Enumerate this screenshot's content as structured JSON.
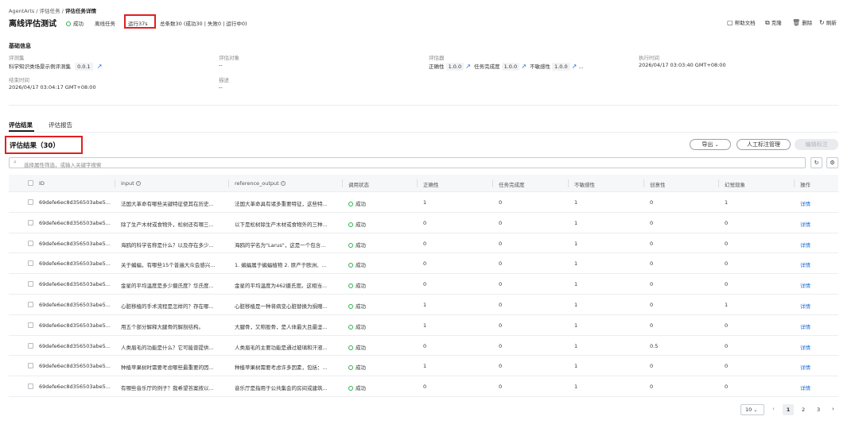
{
  "breadcrumb": [
    "AgentArts",
    "评估任务",
    "评估任务详情"
  ],
  "page_title": "离线评估测试",
  "status": {
    "label": "成功",
    "color": "#2bb34a"
  },
  "task_type": "离线任务",
  "runtime": "运行37s",
  "summary": "总条数30 (成功30 | 失败0 | 运行中0)",
  "toolbar": {
    "help": "帮助文档",
    "clone": "克隆",
    "delete": "删除",
    "refresh": "刷新"
  },
  "basic_info": {
    "section_title": "基础信息",
    "dataset_label": "评测集",
    "dataset_value": "科学知识类场景示例评测集",
    "dataset_version": "0.0.1",
    "target_label": "评估对象",
    "target_value": "--",
    "evaluators_label": "评估器",
    "evaluators": [
      {
        "name": "正确性",
        "version": "1.0.0"
      },
      {
        "name": "任务完成度",
        "version": "1.0.0"
      },
      {
        "name": "不敏感性",
        "version": "1.0.0"
      }
    ],
    "evaluators_more": "...",
    "exec_time_label": "执行时间",
    "exec_time_value": "2026/04/17 03:03:40 GMT+08:00",
    "end_time_label": "结束时间",
    "end_time_value": "2026/04/17 03:04:17 GMT+08:00",
    "desc_label": "描述",
    "desc_value": "--"
  },
  "tabs": [
    {
      "label": "评估结果",
      "active": true
    },
    {
      "label": "评估报告",
      "active": false
    }
  ],
  "results": {
    "title": "评估结果（30）",
    "export_label": "导出",
    "annotate_label": "人工标注管理",
    "batch_label": "编辑标注",
    "search_placeholder": "选择属性筛选，或输入关键字搜索"
  },
  "table": {
    "columns": [
      "ID",
      "input",
      "reference_output",
      "调用状态",
      "正确性",
      "任务完成度",
      "不敏感性",
      "创意性",
      "幻觉现象",
      "操作"
    ],
    "status_label": "成功",
    "action_label": "详情",
    "rows": [
      {
        "id": "69defe6ec8d356503abe5...",
        "input": "法国大革命有哪些关键特征使其在历史...",
        "ref": "法国大革命具有诸多重要特征，这些特...",
        "c1": "1",
        "c2": "0",
        "c3": "1",
        "c4": "0",
        "c5": "1"
      },
      {
        "id": "69defe6ec8d356503abe5...",
        "input": "除了生产木材或食物外，松树还有哪三...",
        "ref": "以下是松树除生产木材或食物外的三种...",
        "c1": "0",
        "c2": "0",
        "c3": "1",
        "c4": "0",
        "c5": "0"
      },
      {
        "id": "69defe6ec8d356503abe5...",
        "input": "海鸥的科学名称是什么？以及存在多少...",
        "ref": "海鸥的学名为\"Larus\"，这是一个包含...",
        "c1": "0",
        "c2": "0",
        "c3": "1",
        "c4": "0",
        "c5": "0"
      },
      {
        "id": "69defe6ec8d356503abe5...",
        "input": "关于蝙蝠，有哪些15个普遍大众会感兴...",
        "ref": "1. 蝙蝠属于蝙蝠植物 2. 原产于欧洲、...",
        "c1": "0",
        "c2": "0",
        "c3": "1",
        "c4": "0",
        "c5": "0"
      },
      {
        "id": "69defe6ec8d356503abe5...",
        "input": "金星的平均温度是多少摄氏度？华氏度...",
        "ref": "金星的平均温度为462摄氏度。这相当...",
        "c1": "0",
        "c2": "0",
        "c3": "1",
        "c4": "0",
        "c5": "0"
      },
      {
        "id": "69defe6ec8d356503abe5...",
        "input": "心脏移植的手术流程是怎样的？存在哪...",
        "ref": "心脏移植是一种将病变心脏替换为捐赠...",
        "c1": "1",
        "c2": "0",
        "c3": "1",
        "c4": "0",
        "c5": "1"
      },
      {
        "id": "69defe6ec8d356503abe5...",
        "input": "用五个部分解释大腱骨的解剖结构。",
        "ref": "大腱骨，又称股骨，是人体最大且最坚...",
        "c1": "1",
        "c2": "0",
        "c3": "1",
        "c4": "0",
        "c5": "0"
      },
      {
        "id": "69defe6ec8d356503abe5...",
        "input": "人类眉毛的功能是什么？它可能曾提供...",
        "ref": "人类眉毛的主要功能是通过玻璃和汗液...",
        "c1": "0",
        "c2": "0",
        "c3": "1",
        "c4": "0.5",
        "c5": "0"
      },
      {
        "id": "69defe6ec8d356503abe5...",
        "input": "种植苹果树时需要考虑哪些最重要的因...",
        "ref": "种植苹果树需要考虑许多因素，包括：...",
        "c1": "1",
        "c2": "0",
        "c3": "1",
        "c4": "0",
        "c5": "0"
      },
      {
        "id": "69defe6ec8d356503abe5...",
        "input": "有哪些音乐厅的例子？我希望答案按以...",
        "ref": "音乐厅是指用于公共集会的房间或建筑...",
        "c1": "0",
        "c2": "0",
        "c3": "1",
        "c4": "0",
        "c5": "0"
      }
    ]
  },
  "pagination": {
    "page_size": "10",
    "pages": [
      "1",
      "2",
      "3"
    ],
    "current": "1"
  }
}
